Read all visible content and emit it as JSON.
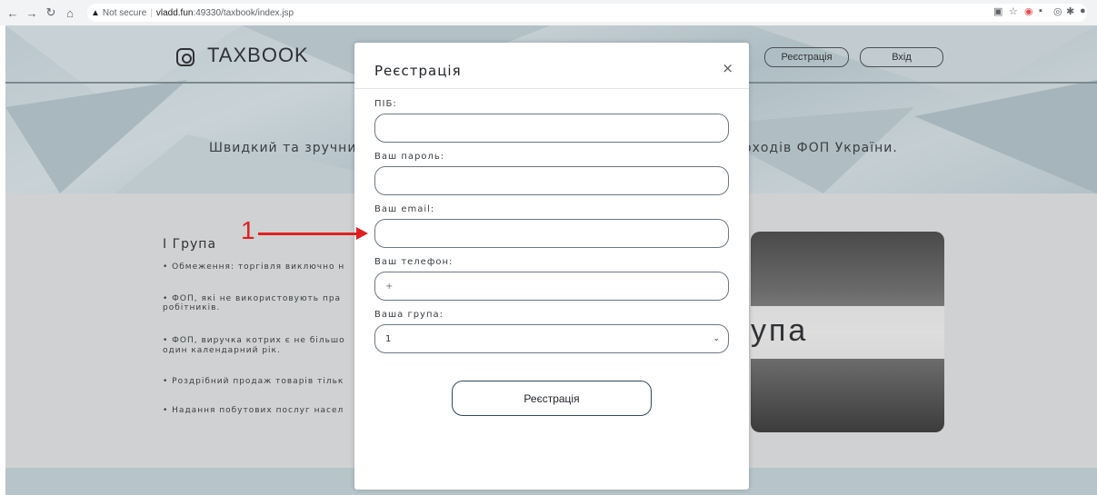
{
  "browser": {
    "security_label": "Not secure",
    "host": "vladd.fun",
    "path": ":49330/taxbook/index.jsp"
  },
  "header": {
    "logo_text": "TAXBOOK",
    "register_label": "Реєстрація",
    "login_label": "Вхід"
  },
  "hero": {
    "tagline_left": "Швидкий та зручний",
    "tagline_right": "оходів ФОП України."
  },
  "group": {
    "title": "І Група",
    "bullets": [
      "• Обмеження: торгівля виключно н",
      "• ФОП, які не використовують пра",
      "робітників.",
      "• ФОП, виручка котрих є не більшо",
      "один календарний рік.",
      "• Роздрібний продаж товарів тільк",
      "• Надання побутових послуг насел"
    ],
    "photo_text": "упа"
  },
  "modal": {
    "title": "Реєстрація",
    "close": "×",
    "fields": {
      "name_label": "ПІБ:",
      "password_label": "Ваш пароль:",
      "email_label": "Ваш email:",
      "phone_label": "Ваш телефон:",
      "phone_placeholder": "+",
      "group_label": "Ваша група:",
      "group_value": "1"
    },
    "submit_label": "Реєстрація"
  },
  "annotation": {
    "number": "1"
  },
  "colors": {
    "annotation": "#e02020",
    "button_border": "#2f4a5c"
  }
}
